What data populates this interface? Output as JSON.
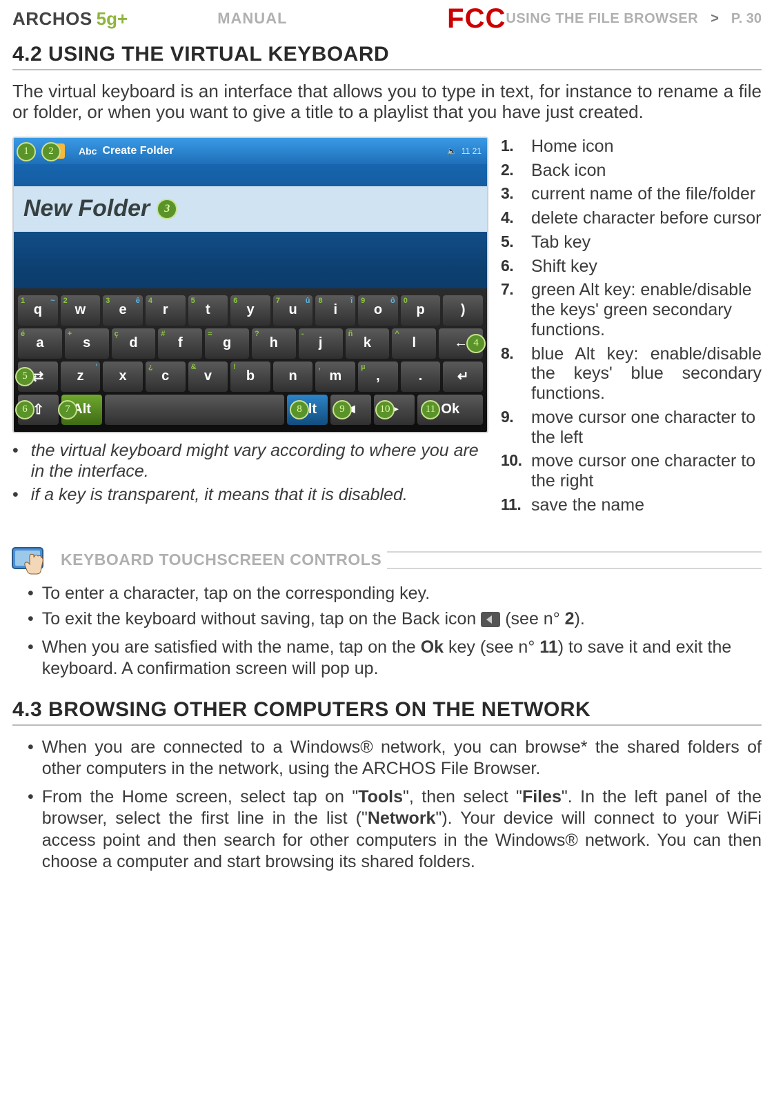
{
  "header": {
    "brand": "ARCHOS",
    "model": "5g+",
    "manual": "MANUAL",
    "fcc": "FCC",
    "breadcrumb": "USING THE FILE BROWSER",
    "gt": ">",
    "page": "P. 30"
  },
  "section42": {
    "title": "4.2 USING THE VIRTUAL KEYBOARD",
    "intro": "The virtual keyboard is an interface that allows you to type in text, for instance to rename a file or folder, or when you want to give a title to a playlist that you have just created."
  },
  "keyboard_mock": {
    "top_title": "Create Folder",
    "abc": "Abc",
    "clock": "11 21",
    "field_text": "New Folder",
    "row1": [
      {
        "sup": "1",
        "supb": "~",
        "ch": "q"
      },
      {
        "sup": "2",
        "supb": "",
        "ch": "w"
      },
      {
        "sup": "3",
        "supb": "ê",
        "ch": "e"
      },
      {
        "sup": "4",
        "supb": "",
        "ch": "r"
      },
      {
        "sup": "5",
        "supb": "",
        "ch": "t"
      },
      {
        "sup": "6",
        "supb": "",
        "ch": "y"
      },
      {
        "sup": "7",
        "supb": "û",
        "ch": "u"
      },
      {
        "sup": "8",
        "supb": "î",
        "ch": "i"
      },
      {
        "sup": "9",
        "supb": "ô",
        "ch": "o"
      },
      {
        "sup": "0",
        "supb": "",
        "ch": "p"
      },
      {
        "sup": "",
        "supb": "",
        "ch": ")"
      }
    ],
    "row2": [
      {
        "sup": "é",
        "supb": "",
        "ch": "a"
      },
      {
        "sup": "+",
        "supb": "",
        "ch": "s"
      },
      {
        "sup": "ç",
        "supb": "",
        "ch": "d"
      },
      {
        "sup": "#",
        "supb": "",
        "ch": "f"
      },
      {
        "sup": "=",
        "supb": "",
        "ch": "g"
      },
      {
        "sup": "?",
        "supb": "",
        "ch": "h"
      },
      {
        "sup": "-",
        "supb": "",
        "ch": "j"
      },
      {
        "sup": "ñ",
        "supb": "",
        "ch": "k"
      },
      {
        "sup": "^",
        "supb": "",
        "ch": "l"
      },
      {
        "sup": "",
        "supb": "",
        "ch": "←"
      }
    ],
    "row3": [
      {
        "ch": "⇄"
      },
      {
        "sup": "",
        "supb": "'",
        "ch": "z"
      },
      {
        "sup": "",
        "supb": "",
        "ch": "x"
      },
      {
        "sup": "¿",
        "supb": "",
        "ch": "c"
      },
      {
        "sup": "&",
        "supb": "",
        "ch": "v"
      },
      {
        "sup": "!",
        "supb": "",
        "ch": "b"
      },
      {
        "sup": "",
        "supb": "",
        "ch": "n"
      },
      {
        "sup": ",",
        "supb": "",
        "ch": "m"
      },
      {
        "sup": "µ",
        "supb": "",
        "ch": ","
      },
      {
        "sup": "",
        "supb": "",
        "ch": "."
      },
      {
        "ch": "↵"
      }
    ],
    "row4": {
      "shift": "⇧",
      "alt_green": "Alt",
      "space": "",
      "alt_blue": "Alt",
      "left": "◄",
      "right": "►",
      "ok": "Ok"
    },
    "badges": {
      "b1": "1",
      "b2": "2",
      "b3": "3",
      "b4": "4",
      "b5": "5",
      "b6": "6",
      "b7": "7",
      "b8": "8",
      "b9": "9",
      "b10": "10",
      "b11": "11"
    }
  },
  "legend": [
    "Home icon",
    "Back icon",
    "current name of the file/folder",
    "delete character before cursor",
    "Tab key",
    "Shift key",
    "green Alt key: enable/disable the keys' green secondary functions.",
    "blue Alt key: enable/disable the keys' blue secondary functions.",
    "move cursor one character to the left",
    "move cursor one character to the right",
    "save the name"
  ],
  "legend_nums": [
    "1.",
    "2.",
    "3.",
    "4.",
    "5.",
    "6.",
    "7.",
    "8.",
    "9.",
    "10.",
    "11."
  ],
  "notes": [
    "the virtual keyboard might vary according to where you are in the interface.",
    "if a key is transparent, it means that it is disabled."
  ],
  "touch": {
    "title": "KEYBOARD TOUCHSCREEN CONTROLS",
    "items": {
      "i1": "To enter a character, tap on the corresponding key.",
      "i2a": "To exit the keyboard without saving, tap on the Back icon ",
      "i2b": " (see n° ",
      "i2c": "2",
      "i2d": ").",
      "i3a": "When you are satisfied with the name, tap on the ",
      "i3b": "Ok",
      "i3c": " key (see n° ",
      "i3d": "11",
      "i3e": ") to save it and exit the keyboard. A confirmation screen will pop up."
    }
  },
  "section43": {
    "title": "4.3 BROWSING OTHER COMPUTERS ON THE NETWORK",
    "items": {
      "n1": "When you are connected to a Windows® network, you can browse* the shared folders of other computers in the network, using the ARCHOS File Browser.",
      "n2a": "From the Home screen, select tap on \"",
      "n2b": "Tools",
      "n2c": "\", then select \"",
      "n2d": "Files",
      "n2e": "\". In the left panel of the browser, select the first line in the list (\"",
      "n2f": "Network",
      "n2g": "\"). Your device will connect to your WiFi access point and then search for other computers in the Windows® network. You can then choose a computer and start browsing its shared folders."
    }
  }
}
